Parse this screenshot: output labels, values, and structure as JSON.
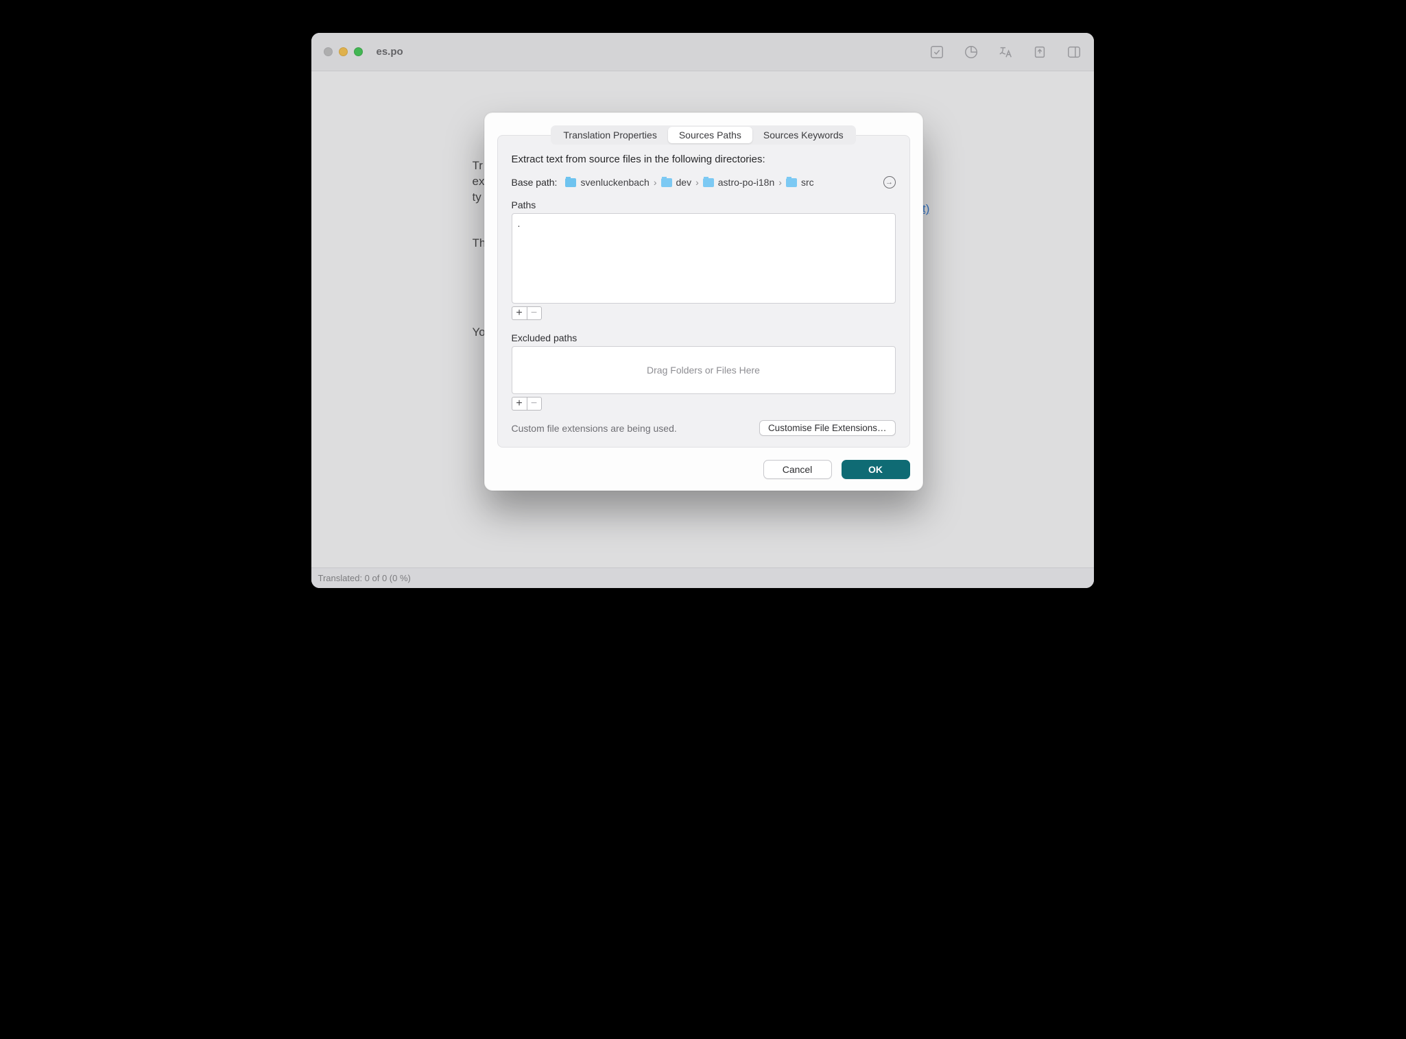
{
  "window": {
    "title": "es.po"
  },
  "statusbar": {
    "text": "Translated: 0 of 0 (0 %)"
  },
  "background": {
    "line1_prefix": "Tr",
    "line2_prefix": "ex",
    "line3_prefix": "ty",
    "line4_prefix": "Th",
    "line5_prefix": "Yo",
    "link_tail": "xt)"
  },
  "dialog": {
    "tabs": {
      "properties": "Translation Properties",
      "paths": "Sources Paths",
      "keywords": "Sources Keywords"
    },
    "heading": "Extract text from source files in the following directories:",
    "basepath_label": "Base path:",
    "breadcrumbs": [
      "svenluckenbach",
      "dev",
      "astro-po-i18n",
      "src"
    ],
    "paths_label": "Paths",
    "paths_items": [
      "."
    ],
    "excluded_label": "Excluded paths",
    "excluded_placeholder": "Drag Folders or Files Here",
    "ext_note": "Custom file extensions are being used.",
    "ext_button": "Customise File Extensions…",
    "cancel": "Cancel",
    "ok": "OK"
  }
}
